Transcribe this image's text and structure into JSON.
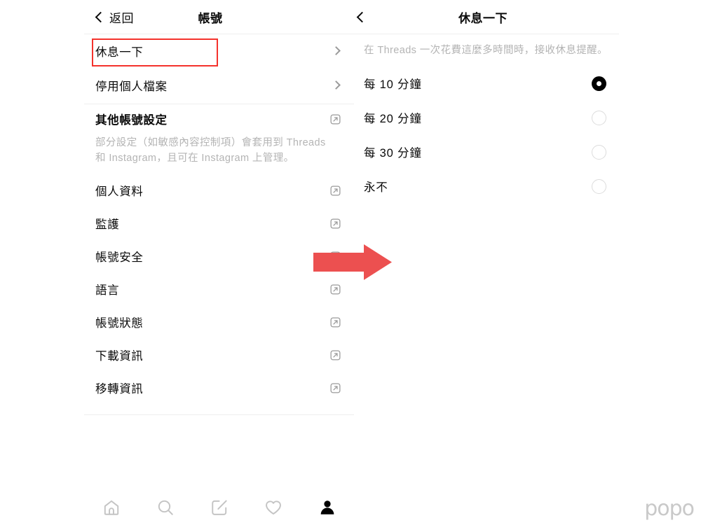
{
  "left_panel": {
    "header": {
      "back_label": "返回",
      "title": "帳號",
      "back_icon": "chevron-left-icon"
    },
    "primary_items": [
      {
        "label": "休息一下",
        "accessory": "chevron-right-icon",
        "highlighted": true
      },
      {
        "label": "停用個人檔案",
        "accessory": "chevron-right-icon",
        "highlighted": false
      }
    ],
    "section": {
      "title": "其他帳號設定",
      "accessory": "external-link-icon",
      "description": "部分設定（如敏感內容控制項）會套用到 Threads 和 Instagram，且可在 Instagram 上管理。"
    },
    "external_items": [
      {
        "label": "個人資料",
        "accessory": "external-link-icon"
      },
      {
        "label": "監護",
        "accessory": "external-link-icon"
      },
      {
        "label": "帳號安全",
        "accessory": "external-link-icon"
      },
      {
        "label": "語言",
        "accessory": "external-link-icon"
      },
      {
        "label": "帳號狀態",
        "accessory": "external-link-icon"
      },
      {
        "label": "下載資訊",
        "accessory": "external-link-icon"
      },
      {
        "label": "移轉資訊",
        "accessory": "external-link-icon"
      }
    ]
  },
  "right_panel": {
    "header": {
      "title": "休息一下",
      "back_icon": "chevron-left-icon"
    },
    "description": "在 Threads 一次花費這麼多時間時，接收休息提醒。",
    "options": [
      {
        "label": "每 10 分鐘",
        "selected": true
      },
      {
        "label": "每 20 分鐘",
        "selected": false
      },
      {
        "label": "每 30 分鐘",
        "selected": false
      },
      {
        "label": "永不",
        "selected": false
      }
    ]
  },
  "bottom_nav": [
    {
      "icon": "home-icon",
      "active": false
    },
    {
      "icon": "search-icon",
      "active": false
    },
    {
      "icon": "compose-icon",
      "active": false
    },
    {
      "icon": "heart-icon",
      "active": false
    },
    {
      "icon": "profile-icon",
      "active": true
    }
  ],
  "annotations": {
    "highlight_box_color": "#f4322c",
    "arrow_color": "#ec5050",
    "arrow_icon": "right-arrow-icon"
  },
  "watermark": {
    "text": "popo",
    "color": "#c9c9c9"
  }
}
